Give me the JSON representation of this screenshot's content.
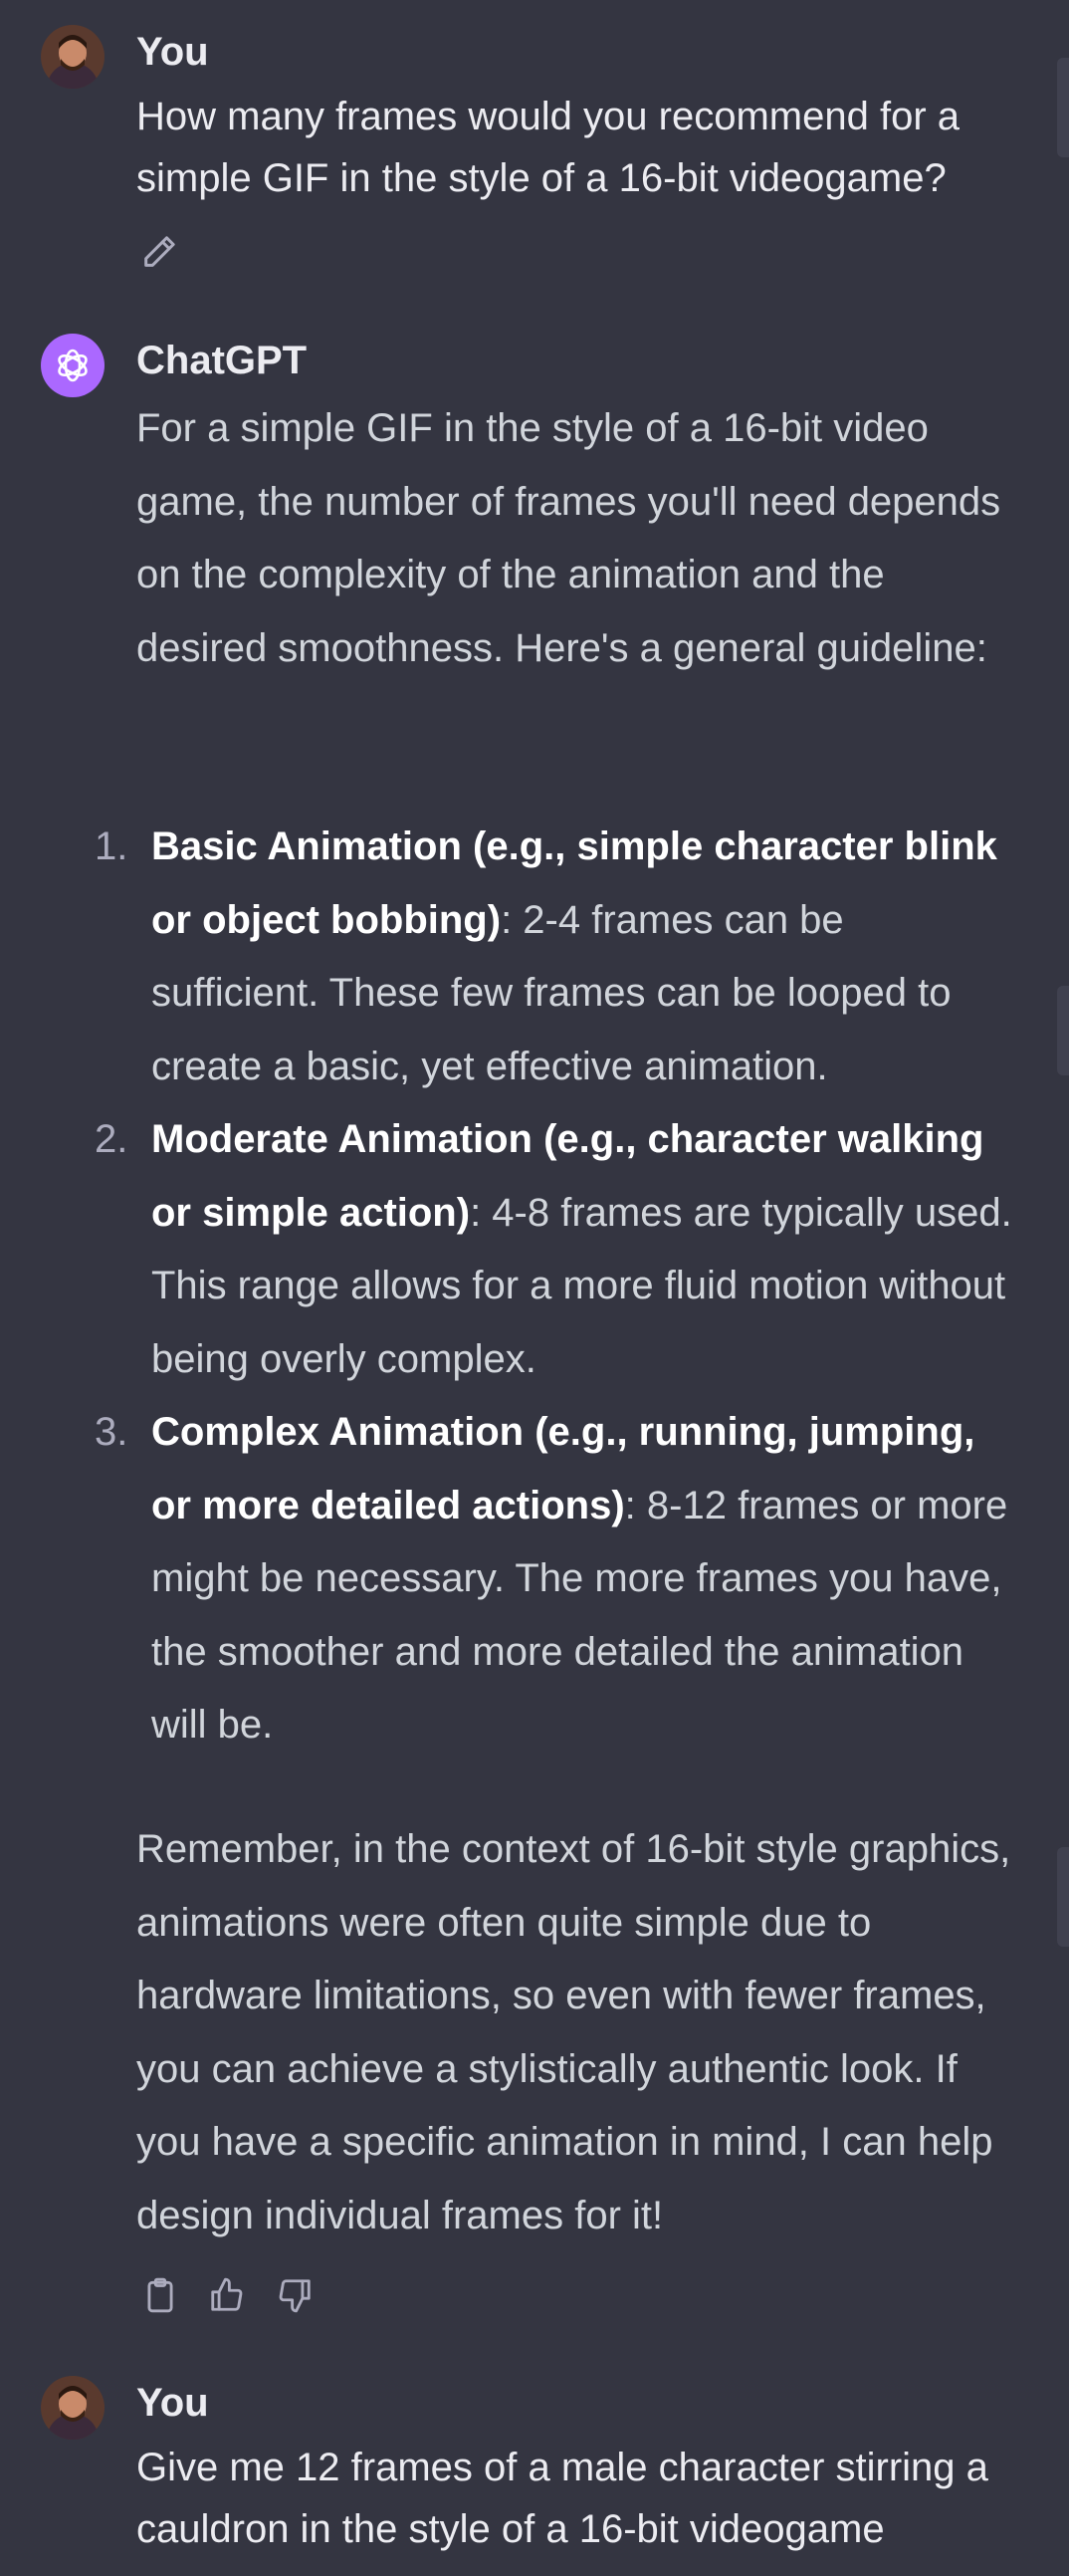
{
  "conversation": {
    "message1": {
      "author": "You",
      "text": "How many frames would you recommend for a simple GIF in the style of a 16-bit videogame?",
      "edit_icon": "pencil-icon"
    },
    "message2": {
      "author": "ChatGPT",
      "intro": "For a simple GIF in the style of a 16-bit video game, the number of frames you'll need depends on the complexity of the animation and the desired smoothness. Here's a general guideline:",
      "items": [
        {
          "number": "1.",
          "title": "Basic Animation (e.g., simple character blink or object bobbing)",
          "text": ": 2-4 frames can be sufficient. These few frames can be looped to create a basic, yet effective animation."
        },
        {
          "number": "2.",
          "title": "Moderate Animation (e.g., character walking or simple action)",
          "text": ": 4-8 frames are typically used. This range allows for a more fluid motion without being overly complex."
        },
        {
          "number": "3.",
          "title": "Complex Animation (e.g., running, jumping, or more detailed actions)",
          "text": ": 8-12 frames or more might be necessary. The more frames you have, the smoother and more detailed the animation will be."
        }
      ],
      "outro": "Remember, in the context of 16-bit style graphics, animations were often quite simple due to hardware limitations, so even with fewer frames, you can achieve a stylistically authentic look. If you have a specific animation in mind, I can help design individual frames for it!",
      "action_icons": [
        "clipboard-icon",
        "thumbs-up-icon",
        "thumbs-down-icon"
      ]
    },
    "message3": {
      "author": "You",
      "text": "Give me 12 frames of a male character stirring a cauldron in the style of a 16-bit videogame"
    }
  },
  "colors": {
    "background": "#343541",
    "text_primary": "#ececf1",
    "text_secondary": "#d1d5db",
    "chatgpt_avatar": "#ab68ff"
  }
}
